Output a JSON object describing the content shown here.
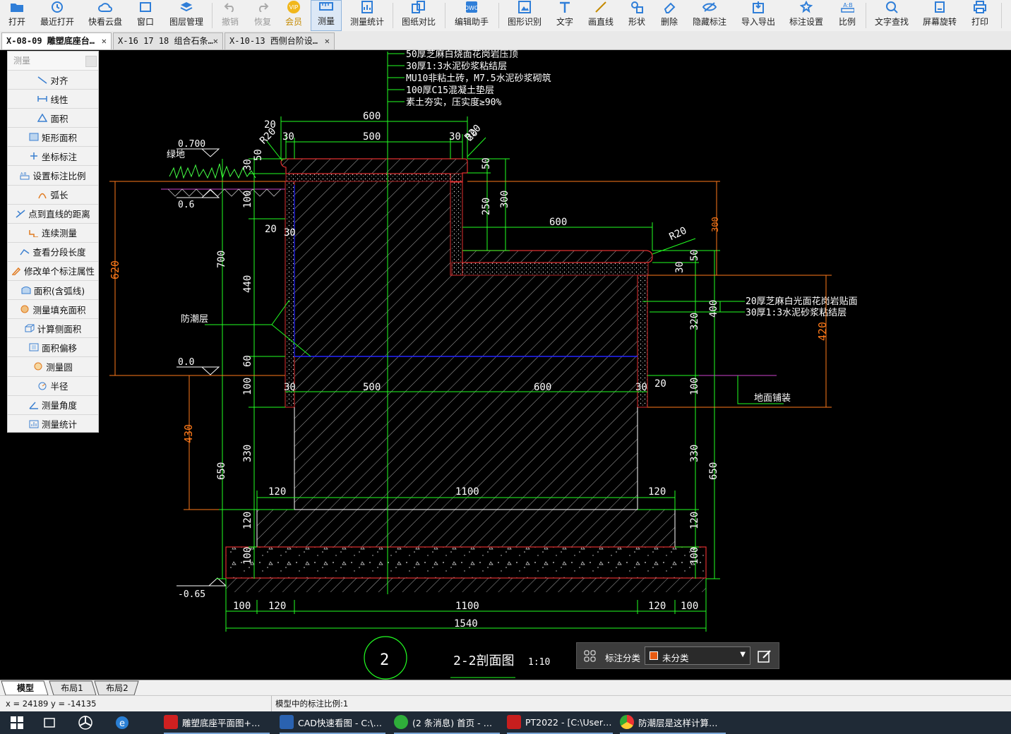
{
  "toolbar": {
    "items": [
      {
        "label": "打开",
        "icon": "folder-icon"
      },
      {
        "label": "最近打开",
        "icon": "history-icon"
      },
      {
        "label": "快看云盘",
        "icon": "cloud-icon"
      },
      {
        "label": "窗口",
        "icon": "window-icon"
      },
      {
        "label": "图层管理",
        "icon": "layers-icon"
      },
      {
        "label": "撤销",
        "icon": "undo-icon"
      },
      {
        "label": "恢复",
        "icon": "redo-icon"
      },
      {
        "label": "会员",
        "icon": "vip-icon",
        "badge": "VIP"
      },
      {
        "label": "测量",
        "icon": "measure-icon"
      },
      {
        "label": "测量统计",
        "icon": "measure-stats-icon"
      },
      {
        "label": "图纸对比",
        "icon": "compare-icon"
      },
      {
        "label": "编辑助手",
        "icon": "edit-assistant-icon"
      },
      {
        "label": "图形识别",
        "icon": "shape-recognition-icon"
      },
      {
        "label": "文字",
        "icon": "text-icon"
      },
      {
        "label": "画直线",
        "icon": "line-icon"
      },
      {
        "label": "形状",
        "icon": "shape-icon"
      },
      {
        "label": "删除",
        "icon": "eraser-icon"
      },
      {
        "label": "隐藏标注",
        "icon": "hide-annotation-icon"
      },
      {
        "label": "导入导出",
        "icon": "import-export-icon"
      },
      {
        "label": "标注设置",
        "icon": "annotation-settings-icon"
      },
      {
        "label": "比例",
        "icon": "scale-icon",
        "badge": "A:B"
      },
      {
        "label": "文字查找",
        "icon": "text-search-icon"
      },
      {
        "label": "屏幕旋转",
        "icon": "rotate-screen-icon"
      },
      {
        "label": "打印",
        "icon": "print-icon"
      }
    ]
  },
  "tabs": [
    {
      "label": "X-08-09 雕塑底座台…",
      "active": true
    },
    {
      "label": "X-16 17 18 组合石条…",
      "active": false
    },
    {
      "label": "X-10-13 西侧台阶设…",
      "active": false
    }
  ],
  "measure_panel": {
    "title": "测量",
    "items": [
      "对齐",
      "线性",
      "面积",
      "矩形面积",
      "坐标标注",
      "设置标注比例",
      "弧长",
      "点到直线的距离",
      "连续测量",
      "查看分段长度",
      "修改单个标注属性",
      "面积(含弧线)",
      "测量填充面积",
      "计算侧面积",
      "面积偏移",
      "测量圆",
      "半径",
      "测量角度",
      "测量统计"
    ]
  },
  "drawing": {
    "notes_top": [
      "50厚芝麻白烧面花岗岩压顶",
      "30厚1:3水泥砂浆粘结层",
      "MU10非粘土砖，M7.5水泥砂浆砌筑",
      "100厚C15混凝土垫层",
      "素土夯实，压实度≥90%"
    ],
    "notes_right": [
      "20厚芝麻白光面花岗岩贴面",
      "30厚1:3水泥砂浆粘结层"
    ],
    "labels": {
      "green": "绿地",
      "moisture": "防潮层",
      "pavement": "地面铺装"
    },
    "elevations": {
      "e1": "0.700",
      "e2": "0.6",
      "e3": "0.0",
      "e4": "-0.65"
    },
    "dims_green": {
      "d600a": "600",
      "d500a": "500",
      "d20a": "20",
      "d30a": "30",
      "d30b": "30",
      "d20b": "20",
      "r20a": "R20",
      "r20b": "R20",
      "r20c": "R20",
      "d50a": "50",
      "d250": "250",
      "d300a": "300",
      "d600b": "600",
      "d50b": "50",
      "d30c": "30",
      "d320": "320",
      "d400": "400",
      "d100a": "100",
      "d330r": "330",
      "d650r": "650",
      "d120r": "120",
      "d100r": "100",
      "d30l": "30",
      "d50l": "50",
      "d100l": "100",
      "d20l": "20",
      "d30l2": "30",
      "d700": "700",
      "d440": "440",
      "d60": "60",
      "d100l2": "100",
      "d330l": "330",
      "d650l": "650",
      "d120l": "120",
      "d100l3": "100",
      "d30bot": "30",
      "d500bot": "500",
      "d600bot": "600",
      "d30bot2": "30",
      "d20bot": "20",
      "d120a": "120",
      "d1100a": "1100",
      "d120b": "120",
      "f100a": "100",
      "f120a": "120",
      "f1100": "1100",
      "f120b": "120",
      "f100b": "100",
      "f1540": "1540"
    },
    "dims_orange": {
      "o620": "620",
      "o430": "430",
      "o300": "300",
      "o420": "420"
    },
    "title": {
      "num": "2",
      "name": "2-2剖面图",
      "scale": "1:10"
    }
  },
  "category_bar": {
    "label": "标注分类",
    "value": "未分类"
  },
  "layout_tabs": [
    "模型",
    "布局1",
    "布局2"
  ],
  "status": {
    "coords": "x = 24189  y = -14135",
    "scale_text": "模型中的标注比例:1"
  },
  "taskbar": {
    "apps": [
      {
        "label": "雕塑底座平面图+…",
        "icon": "wps-icon"
      },
      {
        "label": "CAD快速看图 - C:\\…",
        "icon": "cad-icon"
      },
      {
        "label": "(2 条消息) 首页 - …",
        "icon": "browser-icon"
      },
      {
        "label": "PT2022 - [C:\\User…",
        "icon": "pt-icon"
      },
      {
        "label": "防潮层是这样计算…",
        "icon": "chrome-icon"
      }
    ]
  }
}
